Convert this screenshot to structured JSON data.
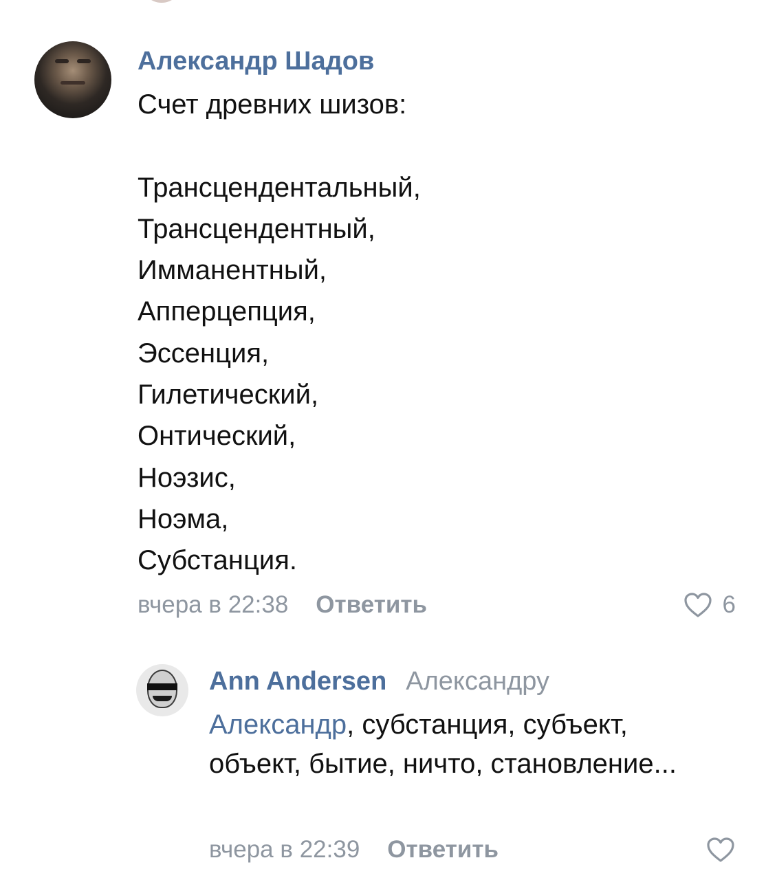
{
  "comment": {
    "author": "Александр Шадов",
    "lines": [
      "Счет древних шизов:",
      "",
      "Трансцендентальный,",
      "Трансцендентный,",
      "Имманентный,",
      "Апперцепция,",
      "Эссенция,",
      "Гилетический,",
      "Онтический,",
      "Ноэзис,",
      "Ноэма,",
      "Субстанция."
    ],
    "text": "Счет древних шизов:\n\nТрансцендентальный,\nТрансцендентный,\nИмманентный,\nАпперцепция,\nЭссенция,\nГилетический,\nОнтический,\nНоэзис,\nНоэма,\nСубстанция.",
    "time": "вчера в 22:38",
    "reply_label": "Ответить",
    "likes": "6"
  },
  "reply": {
    "author": "Ann Andersen",
    "reply_to": "Александру",
    "mention": "Александр",
    "text": ", субстанция, субъект, объект, бытие, ничто, становление...",
    "time": "вчера в 22:39",
    "reply_label": "Ответить"
  },
  "colors": {
    "link": "#4d6f9c",
    "meta": "#8e96a0",
    "text": "#111111"
  },
  "icons": {
    "like": "heart-outline-icon"
  }
}
